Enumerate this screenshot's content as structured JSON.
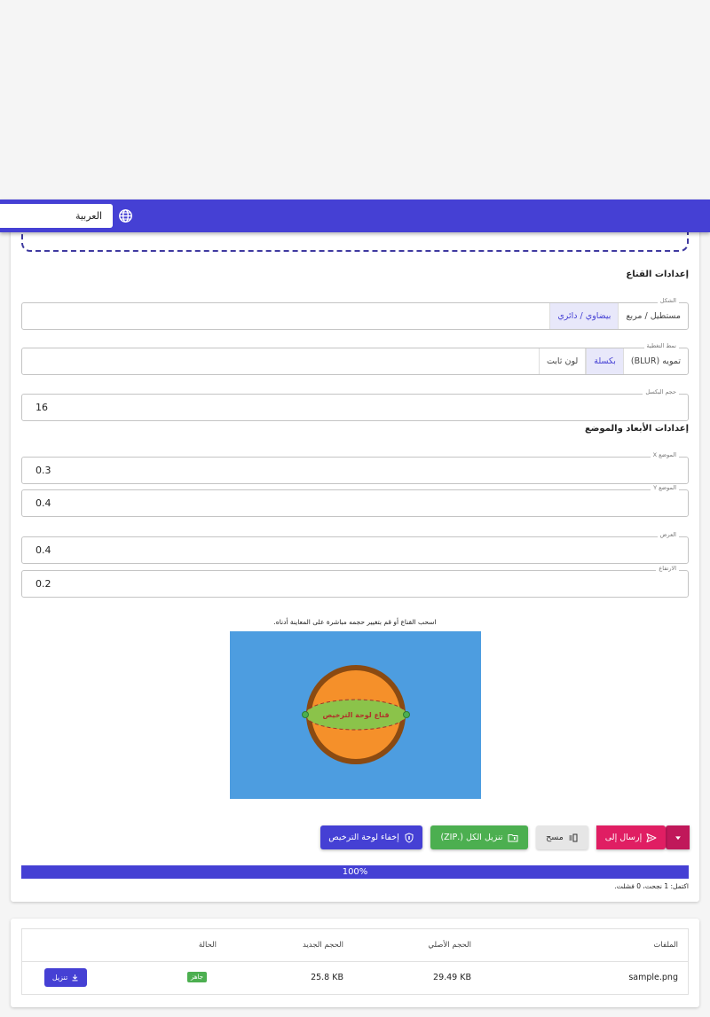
{
  "header": {
    "language": "العربية",
    "language_icon": "globe-icon"
  },
  "mask_settings": {
    "title": "إعدادات القناع",
    "shape": {
      "legend": "الشكل",
      "options": [
        "مستطيل / مربع",
        "بيضاوي / دائري"
      ],
      "selected": "بيضاوي / دائري"
    },
    "cover_style": {
      "legend": "نمط التغطية",
      "options": [
        "تمويه (BLUR)",
        "بكسلة",
        "لون ثابت"
      ],
      "selected": "بكسلة"
    },
    "pixel_size": {
      "legend": "حجم البكسل",
      "value": "16"
    }
  },
  "dimensions": {
    "title": "إعدادات الأبعاد والموضع",
    "x": {
      "legend": "الموضع X",
      "value": "0.3"
    },
    "y": {
      "legend": "الموضع Y",
      "value": "0.4"
    },
    "width": {
      "legend": "العرض",
      "value": "0.4"
    },
    "height": {
      "legend": "الارتفاع",
      "value": "0.2"
    }
  },
  "preview": {
    "hint": "اسحب القناع أو قم بتغيير حجمه مباشرة على المعاينة أدناه.",
    "mask_label": "قناع لوحة الترخيص",
    "colors": {
      "background": "#4d9de0",
      "ball": "#f5902a",
      "ball_border": "#8a4a12",
      "mask": "#8bc34a"
    }
  },
  "actions": {
    "hide_plate": "إخفاء لوحة الترخيص",
    "download_zip": "تنزيل الكل (.ZIP)",
    "clear": "مسح",
    "send_to": "إرسال إلى"
  },
  "progress": {
    "percent_label": "100%",
    "status": "اكتمل: 1 نجحت، 0 فشلت."
  },
  "files": {
    "headers": {
      "name": "الملفات",
      "original_size": "الحجم الأصلي",
      "new_size": "الحجم الجديد",
      "status": "الحالة"
    },
    "rows": [
      {
        "name": "sample.png",
        "original_size": "29.49 KB",
        "new_size": "25.8 KB",
        "status": "جاهز",
        "download": "تنزيل"
      }
    ]
  },
  "colors": {
    "primary": "#4540d4",
    "success": "#4caf50",
    "accent": "#e01e63"
  }
}
